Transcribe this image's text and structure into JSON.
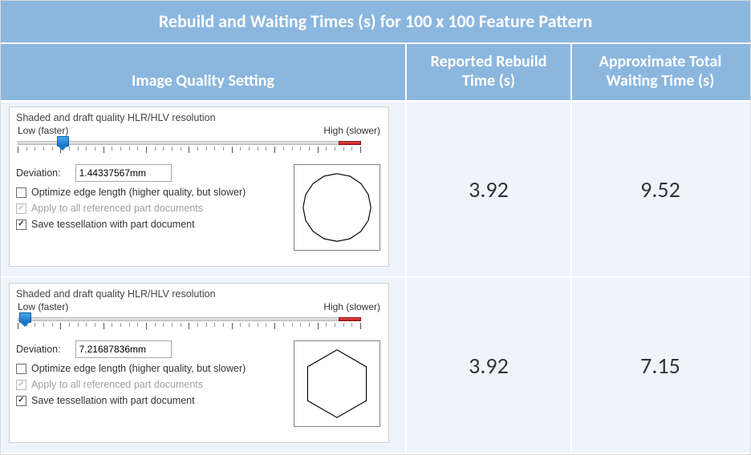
{
  "table": {
    "title": "Rebuild and Waiting Times (s) for 100 x 100 Feature Pattern",
    "headers": {
      "setting": "Image Quality Setting",
      "rebuild": "Reported Rebuild Time (s)",
      "waiting": "Approximate Total Waiting Time (s)"
    }
  },
  "panel_common": {
    "title": "Shaded and draft quality HLR/HLV resolution",
    "low_label": "Low (faster)",
    "high_label": "High (slower)",
    "deviation_label": "Deviation:",
    "optimize_label": "Optimize edge length (higher quality, but slower)",
    "apply_label": "Apply to all referenced part documents",
    "save_label": "Save tessellation with part document"
  },
  "rows": [
    {
      "slider_pos_pct": 13,
      "deviation_value": "1.44337567mm",
      "optimize_checked": false,
      "apply_checked": true,
      "apply_disabled": true,
      "save_checked": true,
      "preview_sides": 16,
      "rebuild_time": "3.92",
      "waiting_time": "9.52"
    },
    {
      "slider_pos_pct": 2,
      "deviation_value": "7.21687836mm",
      "optimize_checked": false,
      "apply_checked": true,
      "apply_disabled": true,
      "save_checked": true,
      "preview_sides": 6,
      "rebuild_time": "3.92",
      "waiting_time": "7.15"
    }
  ]
}
